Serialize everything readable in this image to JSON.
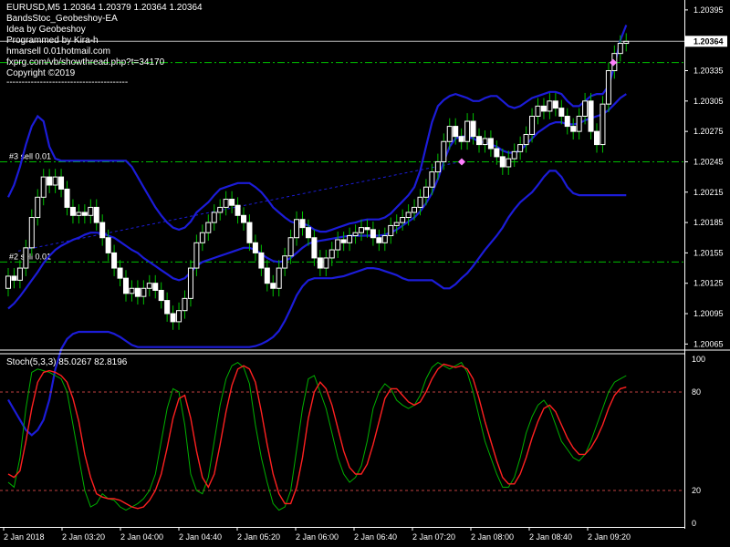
{
  "header": {
    "symbol_line": "EURUSD,M5  1.20364 1.20379 1.20364 1.20364",
    "lines": [
      "BandsStoc_Geobeshoy-EA",
      "Idea by Geobeshoy",
      "Programmed by Kira-h",
      "hmarsell 0.01hotmail.com",
      "fxprg.com/vb/showthread.php?t=34170",
      "Copyright ©2019",
      "----------------------------------------"
    ]
  },
  "current_price_label": "1.20364",
  "stoch_label": "Stoch(5,3,3) 85.0267 82.8196",
  "colors": {
    "background": "#000000",
    "axis": "#ffffff",
    "bull_candle": "#ffffff",
    "bear_candle": "#ffffff",
    "wick": "#00c000",
    "bands": "#1c1cd8",
    "order_line": "#00c000",
    "stoch_main": "#00b000",
    "stoch_signal": "#ff2020",
    "stoch_levels": "#c04040",
    "trade_marker": "#ff80ff"
  },
  "chart_data": [
    {
      "type": "candlestick",
      "symbol": "EURUSD",
      "timeframe": "M5",
      "price_ticks": [
        "1.20395",
        "1.20365",
        "1.20335",
        "1.20305",
        "1.20275",
        "1.20245",
        "1.20215",
        "1.20185",
        "1.20155",
        "1.20125",
        "1.20095",
        "1.20065"
      ],
      "time_ticks": [
        "2 Jan 2018",
        "2 Jan 03:20",
        "2 Jan 04:00",
        "2 Jan 04:40",
        "2 Jan 05:20",
        "2 Jan 06:00",
        "2 Jan 06:40",
        "2 Jan 07:20",
        "2 Jan 08:00",
        "2 Jan 08:40",
        "2 Jan 09:20"
      ],
      "ylim": [
        1.20059,
        1.20403
      ],
      "candles_close": [
        1.20132,
        1.20128,
        1.2014,
        1.2016,
        1.2019,
        1.2021,
        1.2023,
        1.20222,
        1.2023,
        1.20218,
        1.202,
        1.20192,
        1.20195,
        1.20192,
        1.202,
        1.20185,
        1.2017,
        1.20155,
        1.2014,
        1.2013,
        1.20115,
        1.2012,
        1.20112,
        1.2012,
        1.20125,
        1.20118,
        1.20108,
        1.20095,
        1.20087,
        1.20098,
        1.2011,
        1.2014,
        1.20165,
        1.20175,
        1.20185,
        1.20195,
        1.202,
        1.20208,
        1.20202,
        1.20192,
        1.20185,
        1.20165,
        1.20155,
        1.2014,
        1.20125,
        1.2012,
        1.2014,
        1.20152,
        1.2017,
        1.20188,
        1.2018,
        1.2017,
        1.2015,
        1.2014,
        1.2015,
        1.20158,
        1.20168,
        1.20165,
        1.20172,
        1.20175,
        1.2018,
        1.20178,
        1.2017,
        1.20165,
        1.20172,
        1.20182,
        1.20185,
        1.2019,
        1.20195,
        1.202,
        1.2021,
        1.2022,
        1.20235,
        1.20245,
        1.20265,
        1.2028,
        1.2027,
        1.20265,
        1.20285,
        1.2027,
        1.20262,
        1.20268,
        1.20258,
        1.2025,
        1.2024,
        1.20248,
        1.20255,
        1.20262,
        1.20272,
        1.2029,
        1.203,
        1.20295,
        1.20305,
        1.20298,
        1.2029,
        1.2028,
        1.20275,
        1.2029,
        1.20305,
        1.20275,
        1.20262,
        1.20302,
        1.20335,
        1.20352,
        1.20362,
        1.20364
      ],
      "candles_open": [
        1.2012,
        1.20132,
        1.20128,
        1.2014,
        1.2016,
        1.2019,
        1.2021,
        1.2023,
        1.20222,
        1.2023,
        1.20218,
        1.202,
        1.20192,
        1.20195,
        1.20192,
        1.202,
        1.20185,
        1.2017,
        1.20155,
        1.2014,
        1.2013,
        1.20115,
        1.2012,
        1.20112,
        1.2012,
        1.20125,
        1.20118,
        1.20108,
        1.20095,
        1.20087,
        1.20098,
        1.2011,
        1.2014,
        1.20165,
        1.20175,
        1.20185,
        1.20195,
        1.202,
        1.20208,
        1.20202,
        1.20192,
        1.20185,
        1.20165,
        1.20155,
        1.2014,
        1.20125,
        1.2012,
        1.2014,
        1.20152,
        1.2017,
        1.20188,
        1.2018,
        1.2017,
        1.2015,
        1.2014,
        1.2015,
        1.20158,
        1.20168,
        1.20165,
        1.20172,
        1.20175,
        1.2018,
        1.20178,
        1.2017,
        1.20165,
        1.20172,
        1.20182,
        1.20185,
        1.2019,
        1.20195,
        1.202,
        1.2021,
        1.2022,
        1.20235,
        1.20245,
        1.20265,
        1.2028,
        1.2027,
        1.20265,
        1.20285,
        1.2027,
        1.20262,
        1.20268,
        1.20258,
        1.2025,
        1.2024,
        1.20248,
        1.20255,
        1.20262,
        1.20272,
        1.2029,
        1.203,
        1.20295,
        1.20305,
        1.20298,
        1.2029,
        1.2028,
        1.20275,
        1.2029,
        1.20305,
        1.20275,
        1.20262,
        1.20302,
        1.20335,
        1.20352,
        1.20362
      ],
      "band_upper": [
        1.2021,
        1.20222,
        1.2024,
        1.20262,
        1.2028,
        1.2029,
        1.20285,
        1.2026,
        1.20248,
        1.20246,
        1.20246,
        1.20246,
        1.20246,
        1.20246,
        1.20246,
        1.20246,
        1.20246,
        1.20246,
        1.20246,
        1.20246,
        1.20246,
        1.2024,
        1.2023,
        1.2022,
        1.2021,
        1.202,
        1.20192,
        1.20185,
        1.2018,
        1.20178,
        1.2018,
        1.20186,
        1.20195,
        1.202,
        1.20205,
        1.20212,
        1.20218,
        1.2022,
        1.20222,
        1.20224,
        1.20224,
        1.20224,
        1.2022,
        1.20215,
        1.20208,
        1.202,
        1.20195,
        1.2019,
        1.20186,
        1.20184,
        1.20184,
        1.20182,
        1.20178,
        1.20176,
        1.20176,
        1.20178,
        1.2018,
        1.20182,
        1.20184,
        1.20185,
        1.20187,
        1.20188,
        1.20188,
        1.20188,
        1.2019,
        1.20194,
        1.202,
        1.20206,
        1.20212,
        1.2022,
        1.20236,
        1.2026,
        1.20284,
        1.203,
        1.20306,
        1.2031,
        1.20312,
        1.2031,
        1.20308,
        1.20305,
        1.20305,
        1.20308,
        1.2031,
        1.2031,
        1.20305,
        1.203,
        1.20298,
        1.203,
        1.20304,
        1.20308,
        1.2031,
        1.20312,
        1.20314,
        1.20314,
        1.20312,
        1.20305,
        1.203,
        1.203,
        1.20305,
        1.2031,
        1.20312,
        1.20312,
        1.2032,
        1.2034,
        1.20365,
        1.2038
      ],
      "band_middle": [
        1.201,
        1.20105,
        1.20112,
        1.2012,
        1.20128,
        1.20136,
        1.20145,
        1.20152,
        1.20158,
        1.20162,
        1.20165,
        1.20168,
        1.2017,
        1.20173,
        1.20175,
        1.20175,
        1.20174,
        1.20172,
        1.2017,
        1.20166,
        1.20162,
        1.20158,
        1.20155,
        1.2015,
        1.20146,
        1.20142,
        1.20138,
        1.20134,
        1.2013,
        1.20128,
        1.2013,
        1.20136,
        1.20142,
        1.20146,
        1.20148,
        1.2015,
        1.20152,
        1.20154,
        1.20156,
        1.20158,
        1.2016,
        1.2016,
        1.20158,
        1.20154,
        1.2015,
        1.20147,
        1.20146,
        1.20147,
        1.2015,
        1.20155,
        1.2016,
        1.20164,
        1.20166,
        1.20167,
        1.20168,
        1.20169,
        1.2017,
        1.20171,
        1.20172,
        1.20172,
        1.20172,
        1.20172,
        1.20172,
        1.20172,
        1.20173,
        1.20175,
        1.20178,
        1.20182,
        1.20186,
        1.2019,
        1.20196,
        1.20204,
        1.20214,
        1.20228,
        1.20245,
        1.2026,
        1.20268,
        1.2027,
        1.2027,
        1.20268,
        1.20265,
        1.20264,
        1.20262,
        1.2026,
        1.20256,
        1.20254,
        1.20254,
        1.20256,
        1.20262,
        1.20268,
        1.20274,
        1.20278,
        1.20282,
        1.20284,
        1.20284,
        1.20282,
        1.20282,
        1.20283,
        1.20286,
        1.20288,
        1.2029,
        1.20292,
        1.20296,
        1.20302,
        1.20308,
        1.20312
      ],
      "band_lower": [
        1.2001,
        1.2,
        1.1999,
        1.1998,
        1.19975,
        1.1998,
        1.1999,
        1.2001,
        1.2004,
        1.2006,
        1.2007,
        1.20075,
        1.20077,
        1.20077,
        1.20077,
        1.20077,
        1.20077,
        1.20077,
        1.20075,
        1.20072,
        1.20068,
        1.20064,
        1.20062,
        1.20062,
        1.20062,
        1.20062,
        1.20062,
        1.20062,
        1.20062,
        1.20062,
        1.20062,
        1.20062,
        1.20062,
        1.20062,
        1.20062,
        1.20062,
        1.20062,
        1.20062,
        1.20062,
        1.20062,
        1.20062,
        1.20062,
        1.20063,
        1.20065,
        1.20068,
        1.20072,
        1.20078,
        1.20088,
        1.201,
        1.20113,
        1.20122,
        1.20128,
        1.2013,
        1.2013,
        1.2013,
        1.2013,
        1.20131,
        1.20132,
        1.20134,
        1.20136,
        1.20138,
        1.2014,
        1.2014,
        1.20139,
        1.20137,
        1.20135,
        1.20133,
        1.2013,
        1.20128,
        1.20128,
        1.20128,
        1.20128,
        1.20128,
        1.20124,
        1.2012,
        1.2012,
        1.20124,
        1.2013,
        1.20135,
        1.20142,
        1.2015,
        1.20158,
        1.20165,
        1.20172,
        1.2018,
        1.2019,
        1.20198,
        1.20205,
        1.2021,
        1.20215,
        1.20222,
        1.2023,
        1.20236,
        1.20236,
        1.2023,
        1.2022,
        1.20214,
        1.20212,
        1.20212,
        1.20212,
        1.20212,
        1.20212,
        1.20212,
        1.20212,
        1.20212,
        1.20212
      ],
      "order_lines": [
        {
          "label": "",
          "price": 1.20343
        },
        {
          "label": "#3 sell 0.01",
          "price": 1.20245
        },
        {
          "label": "#2 sell 0.01",
          "price": 1.20146
        }
      ],
      "current_price": 1.20364
    },
    {
      "type": "line",
      "name": "Stoch(5,3,3)",
      "ylim": [
        0,
        100
      ],
      "y_ticks": [
        "100",
        "80",
        "20",
        "0"
      ],
      "levels": [
        80,
        20
      ],
      "main": [
        25,
        22,
        40,
        70,
        92,
        94,
        93,
        92,
        90,
        88,
        80,
        60,
        40,
        20,
        10,
        12,
        18,
        15,
        14,
        10,
        8,
        10,
        12,
        15,
        20,
        30,
        50,
        70,
        82,
        80,
        60,
        30,
        20,
        18,
        28,
        50,
        72,
        88,
        96,
        98,
        95,
        85,
        60,
        40,
        25,
        12,
        8,
        10,
        20,
        45,
        70,
        88,
        90,
        80,
        70,
        55,
        40,
        30,
        25,
        28,
        35,
        50,
        70,
        80,
        85,
        82,
        75,
        72,
        70,
        72,
        78,
        88,
        95,
        98,
        96,
        94,
        96,
        98,
        92,
        80,
        65,
        50,
        40,
        30,
        22,
        22,
        28,
        40,
        55,
        65,
        72,
        75,
        70,
        60,
        50,
        45,
        40,
        38,
        42,
        50,
        60,
        70,
        80,
        86,
        88,
        90
      ],
      "signal": [
        30,
        28,
        32,
        50,
        70,
        86,
        92,
        93,
        92,
        90,
        86,
        76,
        62,
        42,
        28,
        18,
        16,
        15,
        15,
        14,
        12,
        10,
        9,
        10,
        14,
        20,
        30,
        46,
        64,
        76,
        78,
        64,
        44,
        28,
        22,
        30,
        48,
        68,
        84,
        94,
        96,
        94,
        86,
        68,
        48,
        30,
        18,
        12,
        12,
        22,
        40,
        64,
        80,
        86,
        82,
        72,
        58,
        44,
        34,
        30,
        30,
        36,
        48,
        62,
        76,
        82,
        82,
        78,
        74,
        72,
        74,
        80,
        88,
        94,
        97,
        96,
        95,
        96,
        94,
        88,
        76,
        62,
        50,
        38,
        28,
        24,
        24,
        30,
        40,
        52,
        62,
        70,
        72,
        68,
        60,
        52,
        46,
        42,
        42,
        46,
        52,
        60,
        70,
        78,
        82,
        83
      ]
    }
  ]
}
